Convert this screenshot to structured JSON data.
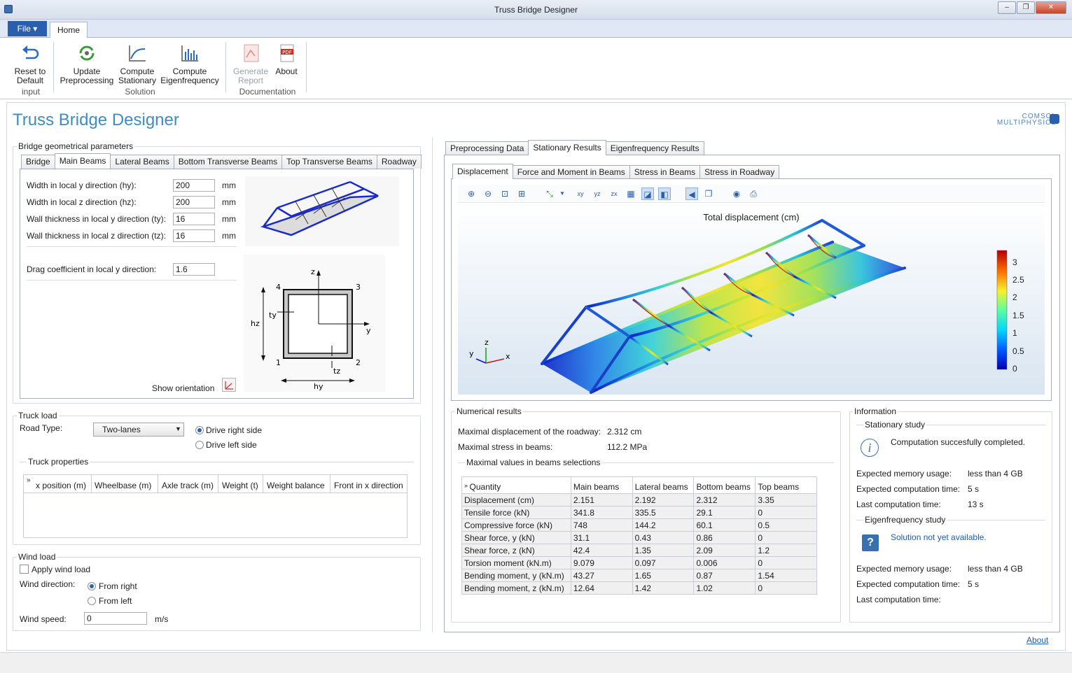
{
  "window": {
    "title": "Truss Bridge Designer"
  },
  "ribbon": {
    "file_label": "File ▾",
    "home_tab": "Home",
    "reset": {
      "line1": "Reset to",
      "line2": "Default"
    },
    "update": {
      "line1": "Update",
      "line2": "Preprocessing"
    },
    "stationary": {
      "line1": "Compute",
      "line2": "Stationary"
    },
    "eigen": {
      "line1": "Compute",
      "line2": "Eigenfrequency"
    },
    "report": {
      "line1": "Generate",
      "line2": "Report"
    },
    "about": {
      "line1": "About"
    },
    "groups": {
      "input": "input",
      "solution": "Solution",
      "documentation": "Documentation"
    }
  },
  "app": {
    "title": "Truss Bridge Designer",
    "logo_line1": "COMSOL",
    "logo_line2": "MULTIPHYSICS"
  },
  "geom": {
    "legend": "Bridge geometrical parameters",
    "tabs": [
      "Bridge",
      "Main Beams",
      "Lateral Beams",
      "Bottom Transverse Beams",
      "Top Transverse Beams",
      "Roadway"
    ],
    "fields": [
      {
        "label": "Width in local y direction (hy):",
        "value": "200",
        "unit": "mm"
      },
      {
        "label": "Width in local z direction (hz):",
        "value": "200",
        "unit": "mm"
      },
      {
        "label": "Wall thickness in local y direction (ty):",
        "value": "16",
        "unit": "mm"
      },
      {
        "label": "Wall thickness in local z direction (tz):",
        "value": "16",
        "unit": "mm"
      }
    ],
    "drag": {
      "label": "Drag coefficient in local y direction:",
      "value": "1.6"
    },
    "show_orientation": "Show orientation",
    "section": {
      "z": "z",
      "y": "y",
      "c1": "1",
      "c2": "2",
      "c3": "3",
      "c4": "4",
      "hz": "hz",
      "hy": "hy",
      "ty": "ty",
      "tz": "tz"
    }
  },
  "truck": {
    "legend": "Truck load",
    "road_type_label": "Road Type:",
    "road_type_value": "Two-lanes",
    "drive_right": "Drive right side",
    "drive_left": "Drive left side",
    "props_legend": "Truck properties",
    "columns": [
      "x position (m)",
      "Wheelbase (m)",
      "Axle track (m)",
      "Weight (t)",
      "Weight balance",
      "Front in x direction"
    ]
  },
  "wind": {
    "legend": "Wind load",
    "apply": "Apply wind load",
    "direction_label": "Wind direction:",
    "from_right": "From right",
    "from_left": "From left",
    "speed_label": "Wind speed:",
    "speed_value": "0",
    "speed_unit": "m/s"
  },
  "results": {
    "tabs": [
      "Preprocessing Data",
      "Stationary Results",
      "Eigenfrequency Results"
    ],
    "subtabs": [
      "Displacement",
      "Force and Moment in Beams",
      "Stress in Beams",
      "Stress in Roadway"
    ],
    "plot_title": "Total displacement (cm)",
    "colorbar_ticks": [
      "3",
      "2.5",
      "2",
      "1.5",
      "1",
      "0.5",
      "0"
    ],
    "axes": {
      "x": "x",
      "y": "y",
      "z": "z"
    }
  },
  "numerical": {
    "legend": "Numerical results",
    "max_disp_label": "Maximal displacement of the roadway:",
    "max_disp_value": "2.312 cm",
    "max_stress_label": "Maximal stress in beams:",
    "max_stress_value": "112.2 MPa",
    "sel_legend": "Maximal values in beams selections",
    "columns": [
      "Quantity",
      "Main beams",
      "Lateral beams",
      "Bottom beams",
      "Top beams"
    ],
    "rows": [
      [
        "Displacement (cm)",
        "2.151",
        "2.192",
        "2.312",
        "3.35"
      ],
      [
        "Tensile force (kN)",
        "341.8",
        "335.5",
        "29.1",
        "0"
      ],
      [
        "Compressive force (kN)",
        "748",
        "144.2",
        "60.1",
        "0.5"
      ],
      [
        "Shear force, y (kN)",
        "31.1",
        "0.43",
        "0.86",
        "0"
      ],
      [
        "Shear force, z (kN)",
        "42.4",
        "1.35",
        "2.09",
        "1.2"
      ],
      [
        "Torsion moment (kN.m)",
        "9.079",
        "0.097",
        "0.006",
        "0"
      ],
      [
        "Bending moment, y (kN.m)",
        "43.27",
        "1.65",
        "0.87",
        "1.54"
      ],
      [
        "Bending moment, z (kN.m)",
        "12.64",
        "1.42",
        "1.02",
        "0"
      ]
    ]
  },
  "info": {
    "legend": "Information",
    "stationary_legend": "Stationary study",
    "stationary_msg": "Computation succesfully completed.",
    "mem_label": "Expected memory usage:",
    "mem_value": "less than 4 GB",
    "time_label": "Expected computation time:",
    "time_value": "5 s",
    "last_label": "Last computation time:",
    "last_value": "13 s",
    "eigen_legend": "Eigenfrequency study",
    "eigen_msg": "Solution not yet available.",
    "eigen_mem_value": "less than 4 GB",
    "eigen_time_value": "5 s"
  },
  "footer": {
    "about_link": "About"
  }
}
